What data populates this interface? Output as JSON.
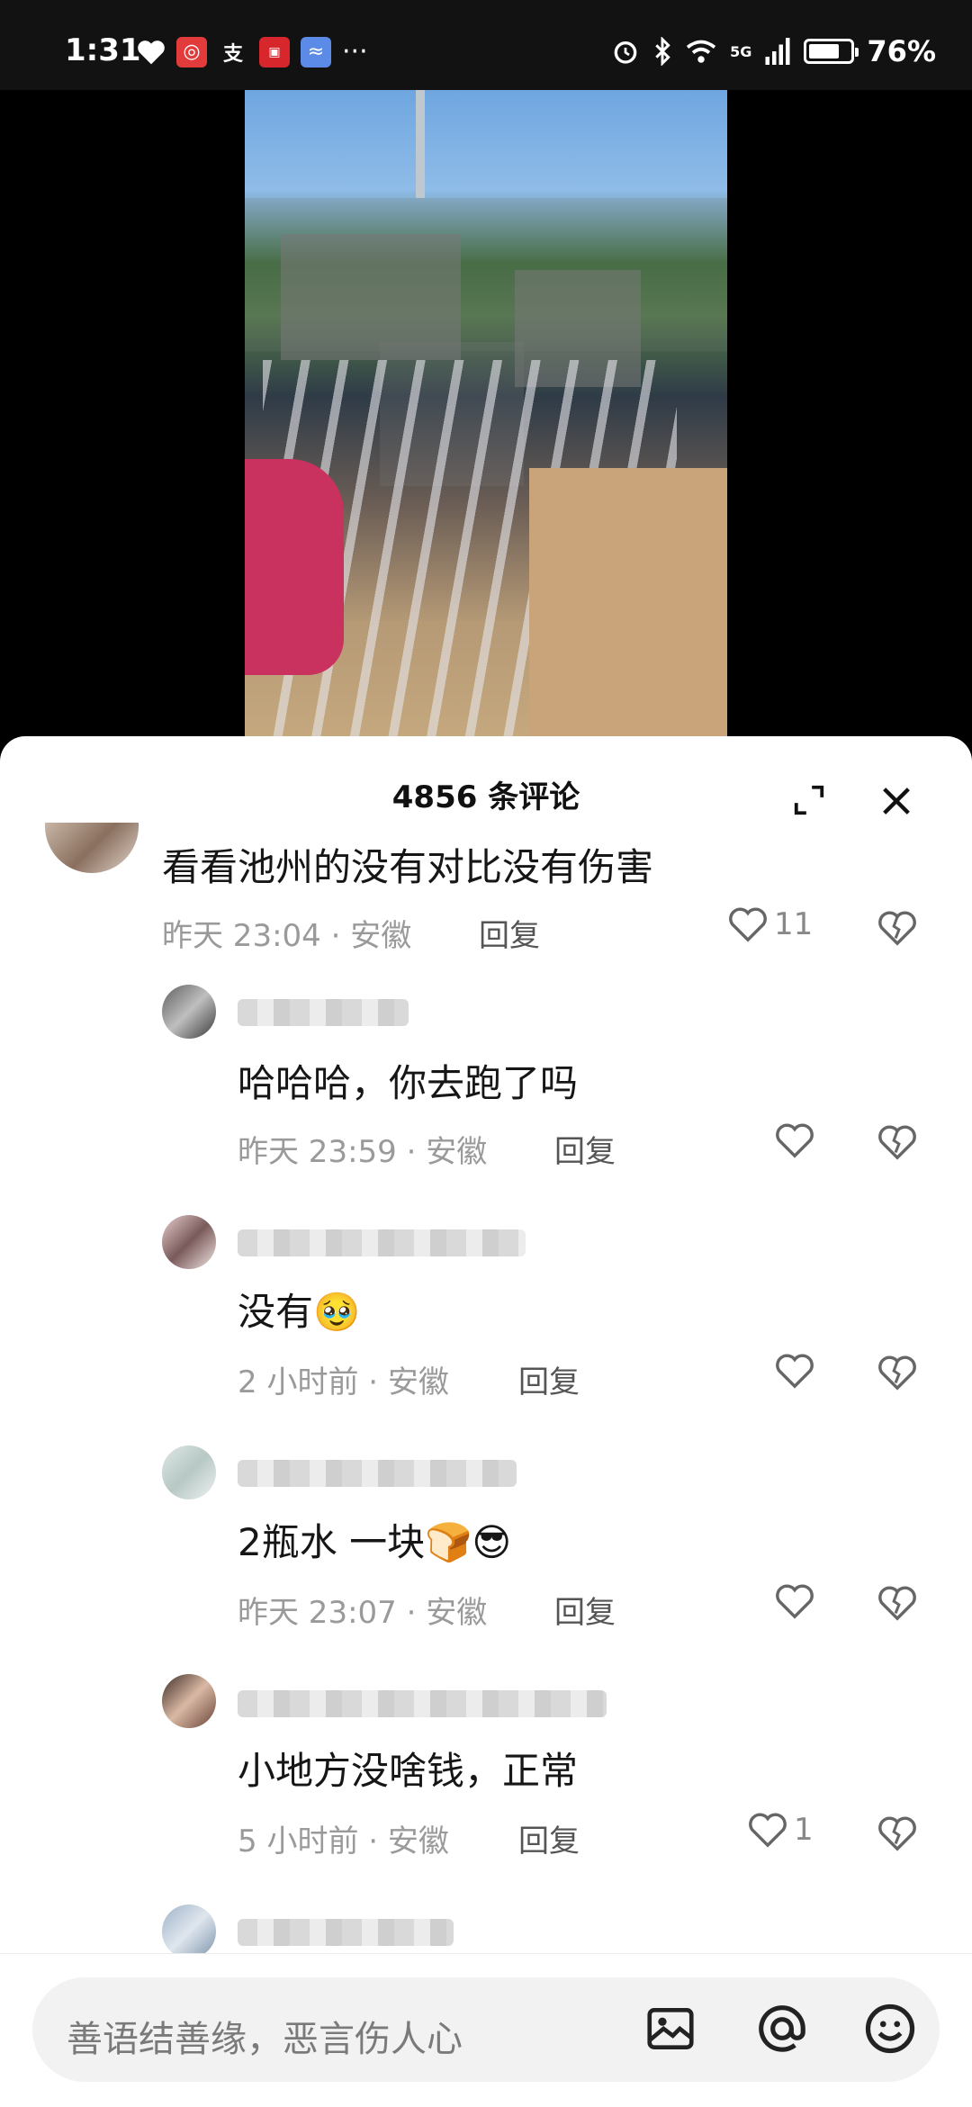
{
  "status_bar": {
    "time": "1:31",
    "battery": "76%",
    "battery_level": 0.76,
    "network": "5G",
    "left_icons": [
      "heart-icon",
      "app-red-icon",
      "alipay-icon",
      "news-app-icon",
      "message-app-icon",
      "more-dots-icon"
    ],
    "right_icons": [
      "alarm-icon",
      "bluetooth-icon",
      "wifi-icon",
      "signal-icon",
      "battery-icon"
    ]
  },
  "video": {
    "description_icon": "video-player"
  },
  "comments_sheet": {
    "title": "4856 条评论",
    "expand_icon": "expand-icon",
    "close_icon": "close-icon"
  },
  "comments": [
    {
      "text": "看看池州的没有对比没有伤害",
      "time": "昨天 23:04",
      "location": "安徽",
      "reply": "回复",
      "likes": "11"
    },
    {
      "text": "哈哈哈，你去跑了吗",
      "time": "昨天 23:59",
      "location": "安徽",
      "reply": "回复",
      "likes": ""
    },
    {
      "text": "没有🥹",
      "time": "2 小时前",
      "location": "安徽",
      "reply": "回复",
      "likes": ""
    },
    {
      "text": "2瓶水 一块🍞😎",
      "time": "昨天 23:07",
      "location": "安徽",
      "reply": "回复",
      "likes": ""
    },
    {
      "text": "小地方没啥钱，正常",
      "time": "5 小时前",
      "location": "安徽",
      "reply": "回复",
      "likes": "1"
    }
  ],
  "separator": " · ",
  "input_bar": {
    "placeholder": "善语结善缘，恶言伤人心",
    "icons": [
      "image-icon",
      "at-icon",
      "emoji-icon"
    ]
  },
  "colors": {
    "background": "#000000",
    "sheet": "#ffffff",
    "meta_text": "#9a9a9a",
    "input_bg": "#f2f2f2"
  }
}
